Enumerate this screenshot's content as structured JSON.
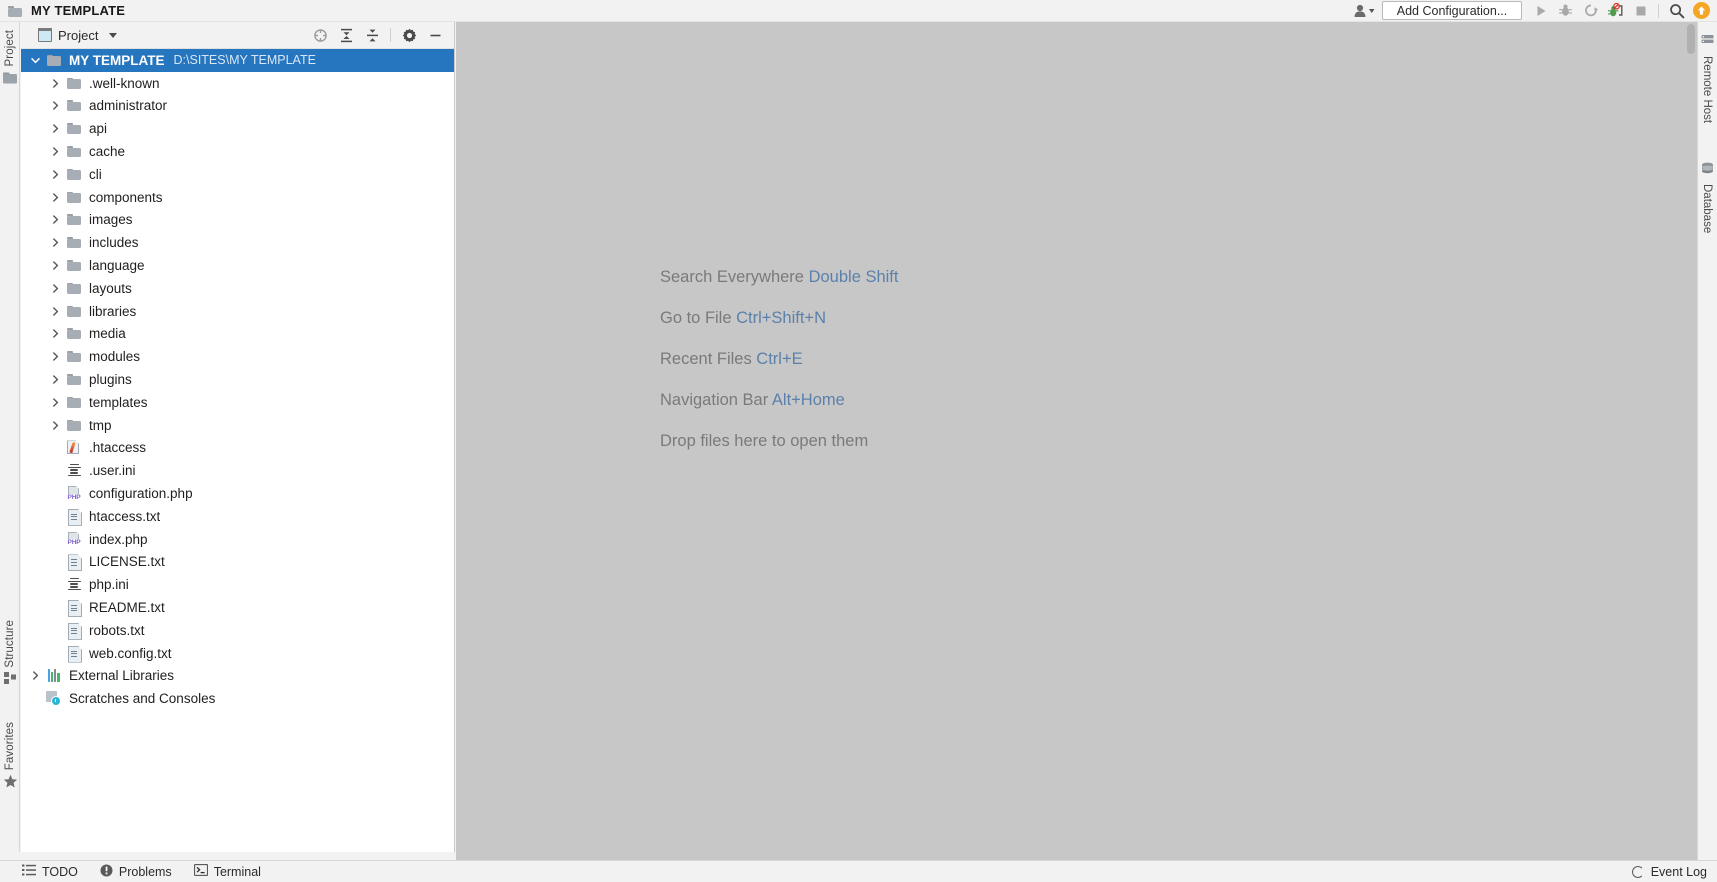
{
  "titlebar": {
    "project_icon": "folder-icon",
    "title": "MY TEMPLATE",
    "user_icon": "user-avatar-icon",
    "add_configuration": "Add Configuration...",
    "run_icon": "run-play-icon",
    "debug_icon": "debug-bug-icon",
    "run_with_coverage_icon": "run-coverage-icon",
    "profile_icon": "profile-disabled-bug-icon",
    "stop_icon": "stop-square-icon",
    "search_icon": "search-magnifier-icon",
    "update_icon": "update-arrow-up-icon"
  },
  "left_strip": {
    "tabs": [
      {
        "label": "Project",
        "icon": "folder-icon"
      },
      {
        "label": "Structure",
        "icon": "structure-blocks-icon"
      },
      {
        "label": "Favorites",
        "icon": "star-icon"
      }
    ]
  },
  "right_strip": {
    "tabs": [
      {
        "label": "Remote Host",
        "icon": "remote-host-icon"
      },
      {
        "label": "Database",
        "icon": "database-icon"
      }
    ]
  },
  "project_panel": {
    "view_selector": "Project",
    "view_icon": "project-view-icon",
    "toolbar_icons": [
      {
        "name": "locate-target-icon"
      },
      {
        "name": "expand-all-icon"
      },
      {
        "name": "collapse-all-icon"
      },
      {
        "name": "settings-gear-icon"
      },
      {
        "name": "hide-minimize-icon"
      }
    ],
    "tree": [
      {
        "label": "MY TEMPLATE",
        "sub": "D:\\SITES\\MY TEMPLATE",
        "icon": "folder-icon",
        "indent": 0,
        "arrow": "expanded",
        "selected": true
      },
      {
        "label": ".well-known",
        "icon": "folder-icon",
        "indent": 1,
        "arrow": "collapsed"
      },
      {
        "label": "administrator",
        "icon": "folder-icon",
        "indent": 1,
        "arrow": "collapsed"
      },
      {
        "label": "api",
        "icon": "folder-icon",
        "indent": 1,
        "arrow": "collapsed"
      },
      {
        "label": "cache",
        "icon": "folder-icon",
        "indent": 1,
        "arrow": "collapsed"
      },
      {
        "label": "cli",
        "icon": "folder-icon",
        "indent": 1,
        "arrow": "collapsed"
      },
      {
        "label": "components",
        "icon": "folder-icon",
        "indent": 1,
        "arrow": "collapsed"
      },
      {
        "label": "images",
        "icon": "folder-icon",
        "indent": 1,
        "arrow": "collapsed"
      },
      {
        "label": "includes",
        "icon": "folder-icon",
        "indent": 1,
        "arrow": "collapsed"
      },
      {
        "label": "language",
        "icon": "folder-icon",
        "indent": 1,
        "arrow": "collapsed"
      },
      {
        "label": "layouts",
        "icon": "folder-icon",
        "indent": 1,
        "arrow": "collapsed"
      },
      {
        "label": "libraries",
        "icon": "folder-icon",
        "indent": 1,
        "arrow": "collapsed"
      },
      {
        "label": "media",
        "icon": "folder-icon",
        "indent": 1,
        "arrow": "collapsed"
      },
      {
        "label": "modules",
        "icon": "folder-icon",
        "indent": 1,
        "arrow": "collapsed"
      },
      {
        "label": "plugins",
        "icon": "folder-icon",
        "indent": 1,
        "arrow": "collapsed"
      },
      {
        "label": "templates",
        "icon": "folder-icon",
        "indent": 1,
        "arrow": "collapsed"
      },
      {
        "label": "tmp",
        "icon": "folder-icon",
        "indent": 1,
        "arrow": "collapsed"
      },
      {
        "label": ".htaccess",
        "icon": "htaccess-file-icon",
        "indent": 1,
        "arrow": "none"
      },
      {
        "label": ".user.ini",
        "icon": "ini-file-icon",
        "indent": 1,
        "arrow": "none"
      },
      {
        "label": "configuration.php",
        "icon": "php-file-icon",
        "indent": 1,
        "arrow": "none"
      },
      {
        "label": "htaccess.txt",
        "icon": "text-file-icon",
        "indent": 1,
        "arrow": "none"
      },
      {
        "label": "index.php",
        "icon": "php-file-icon",
        "indent": 1,
        "arrow": "none"
      },
      {
        "label": "LICENSE.txt",
        "icon": "text-file-icon",
        "indent": 1,
        "arrow": "none"
      },
      {
        "label": "php.ini",
        "icon": "ini-file-icon",
        "indent": 1,
        "arrow": "none"
      },
      {
        "label": "README.txt",
        "icon": "text-file-icon",
        "indent": 1,
        "arrow": "none"
      },
      {
        "label": "robots.txt",
        "icon": "text-file-icon",
        "indent": 1,
        "arrow": "none"
      },
      {
        "label": "web.config.txt",
        "icon": "text-file-icon",
        "indent": 1,
        "arrow": "none"
      },
      {
        "label": "External Libraries",
        "icon": "external-libraries-icon",
        "indent": 0,
        "arrow": "collapsed"
      },
      {
        "label": "Scratches and Consoles",
        "icon": "scratches-icon",
        "indent": 0,
        "arrow": "none"
      }
    ]
  },
  "editor": {
    "hints": [
      {
        "text": "Search Everywhere ",
        "key": "Double Shift"
      },
      {
        "text": "Go to File ",
        "key": "Ctrl+Shift+N"
      },
      {
        "text": "Recent Files ",
        "key": "Ctrl+E"
      },
      {
        "text": "Navigation Bar ",
        "key": "Alt+Home"
      },
      {
        "text": "Drop files here to open them",
        "key": ""
      }
    ]
  },
  "statusbar": {
    "items": [
      {
        "label": "TODO",
        "icon": "todo-list-icon"
      },
      {
        "label": "Problems",
        "icon": "problems-warning-icon"
      },
      {
        "label": "Terminal",
        "icon": "terminal-icon"
      }
    ],
    "event_log": "Event Log",
    "event_log_icon": "event-log-ring-icon"
  },
  "colors": {
    "selection": "#2675bf",
    "editor_background": "#c7c7c7",
    "hint_key": "#5b81ab",
    "accent_update": "#f5a623"
  }
}
